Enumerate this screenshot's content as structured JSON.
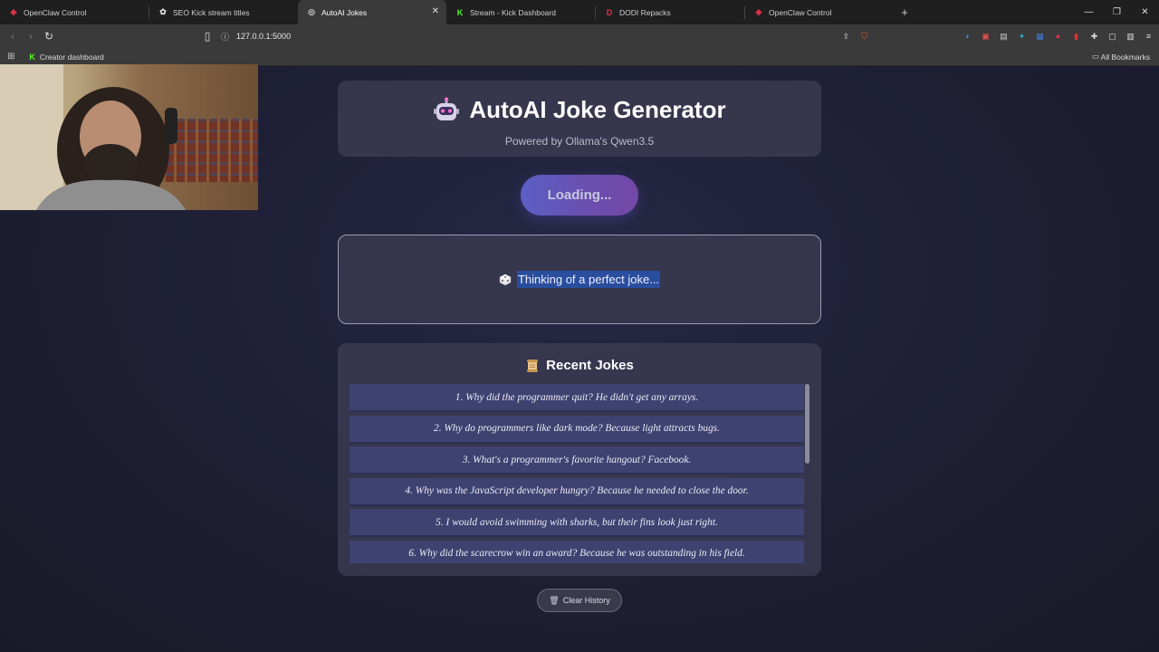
{
  "browser": {
    "tabs": [
      {
        "label": "OpenClaw Control",
        "icon": "openclaw-icon",
        "color": "#d9324a",
        "active": false
      },
      {
        "label": "SEO Kick stream titles",
        "icon": "chatgpt-icon",
        "color": "#dddddd",
        "active": false
      },
      {
        "label": "AutoAI Jokes",
        "icon": "globe-icon",
        "color": "#cccccc",
        "active": true
      },
      {
        "label": "Stream - Kick Dashboard",
        "icon": "kick-icon",
        "color": "#53fc18",
        "active": false
      },
      {
        "label": "DODI Repacks",
        "icon": "dodi-icon",
        "color": "#d9324a",
        "active": false
      },
      {
        "label": "OpenClaw Control",
        "icon": "openclaw-icon",
        "color": "#d9324a",
        "active": false
      }
    ],
    "new_tab": "+",
    "url": "127.0.0.1:5000",
    "bookmarks": {
      "item": "Creator dashboard",
      "all": "All Bookmarks"
    }
  },
  "app": {
    "icon": "robot-icon",
    "title": "AutoAI Joke Generator",
    "subtitle": "Powered by Ollama's Qwen3.5",
    "generate_button": "Loading...",
    "current_joke": {
      "icon": "dice-icon",
      "text": "Thinking of a perfect joke..."
    },
    "recent": {
      "icon": "scroll-icon",
      "title": "Recent Jokes",
      "items": [
        "1. Why did the programmer quit? He didn't get any arrays.",
        "2. Why do programmers like dark mode? Because light attracts bugs.",
        "3. What's a programmer's favorite hangout? Facebook.",
        "4. Why was the JavaScript developer hungry? Because he needed to close the door.",
        "5. I would avoid swimming with sharks, but their fins look just right.",
        "6. Why did the scarecrow win an award? Because he was outstanding in his field."
      ]
    },
    "clear_button": {
      "icon": "trash-icon",
      "label": "Clear History"
    }
  },
  "colors": {
    "accent_start": "#5b5fc4",
    "accent_end": "#7448a6",
    "selection": "#2a4e9e",
    "joke_item_bg": "#3d4270"
  }
}
